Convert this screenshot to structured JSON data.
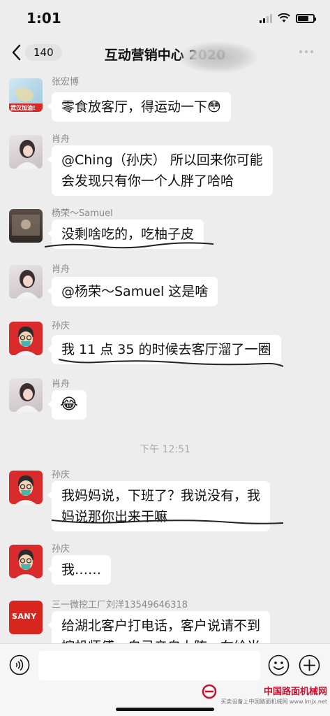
{
  "status": {
    "time": "1:01"
  },
  "nav": {
    "back_count": "140",
    "title": "互动营销中心 2020"
  },
  "messages": [
    {
      "sender": "张宏博",
      "text": "零食放客厅，得运动一下",
      "emoji": "😳",
      "avatar_label": "武汉加油!"
    },
    {
      "sender": "肖舟",
      "line1": "@Ching（孙庆） 所以回来你可能",
      "line2": "会发现只有你一个人胖了哈哈"
    },
    {
      "sender": "杨荣～Samuel",
      "text": "没剩啥吃的，吃柚子皮"
    },
    {
      "sender": "肖舟",
      "text": "@杨荣～Samuel 这是啥"
    },
    {
      "sender": "孙庆",
      "text": "我 11 点 35 的时候去客厅溜了一圈"
    },
    {
      "sender": "肖舟",
      "emoji": "😂"
    },
    {
      "sender": "孙庆",
      "line1": "我妈妈说，下班了？我说没有，我",
      "line2": "妈说那你出来干嘛"
    },
    {
      "sender": "孙庆",
      "text": "我……"
    },
    {
      "sender": "三一微挖工厂刘洋13549646318",
      "line1": "给湖北客户打电话，客户说请不到",
      "line2": "挖机师傅，自己亲自上阵，在给当",
      "avatar_label": "SANY"
    }
  ],
  "time_divider": "下午 12:51",
  "input": {
    "placeholder": ""
  },
  "watermark": {
    "title": "中国路面机械网",
    "subtitle": "买卖设备上中国路面机械网 www.lmjx.net"
  },
  "icons": {
    "back": "chevron-left-icon",
    "more": "more-dots-icon",
    "voice": "voice-icon",
    "emoji": "emoji-icon",
    "add": "add-icon",
    "signal": "signal-icon",
    "wifi": "wifi-icon",
    "battery": "battery-icon"
  },
  "colors": {
    "bg": "#ededed",
    "bubble": "#ffffff",
    "meta_text": "#888888",
    "sany_red": "#d7261e",
    "watermark_red": "#c8102e"
  }
}
